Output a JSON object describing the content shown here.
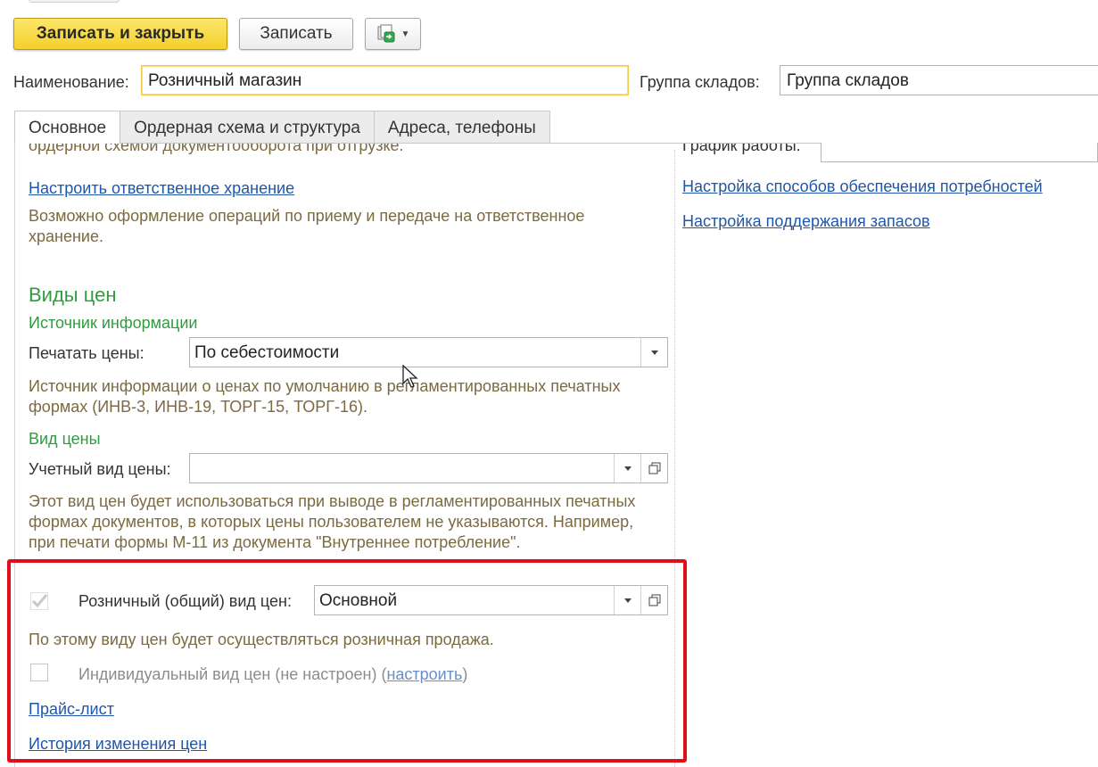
{
  "toolbar": {
    "save_close_label": "Записать и закрыть",
    "save_label": "Записать",
    "more_icon": "document-structure-icon"
  },
  "header": {
    "name_label": "Наименование:",
    "name_value": "Розничный магазин",
    "group_label": "Группа складов:",
    "group_value": "Группа складов"
  },
  "tabs": [
    {
      "label": "Основное",
      "active": true
    },
    {
      "label": "Ордерная схема и структура",
      "active": false
    },
    {
      "label": "Адреса, телефоны",
      "active": false
    }
  ],
  "left": {
    "clipped_text": "ордерной схемой документооборота при отгрузке.",
    "responsible_link": "Настроить ответственное хранение",
    "responsible_desc": "Возможно оформление операций по приему и передаче на ответственное хранение.",
    "price_types_heading": "Виды цен",
    "info_source_heading": "Источник информации",
    "print_prices_label": "Печатать цены:",
    "print_prices_value": "По себестоимости",
    "print_prices_desc": "Источник информации о ценах по умолчанию в регламентированных печатных формах (ИНВ-3, ИНВ-19, ТОРГ-15, ТОРГ-16).",
    "price_type_heading": "Вид цены",
    "account_price_label": "Учетный вид цены:",
    "account_price_value": "",
    "account_price_desc": "Этот вид цен будет использоваться при выводе в регламентированных печатных формах документов, в которых цены пользователем не указываются. Например, при печати формы М-11 из документа \"Внутреннее потребление\".",
    "retail_checkbox_label": "Розничный (общий) вид цен:",
    "retail_checked": true,
    "retail_value": "Основной",
    "retail_desc": "По этому виду цен будет осуществляться розничная продажа.",
    "individual_label": "Индивидуальный вид цен (не настроен) (",
    "individual_link": "настроить",
    "individual_close": ")",
    "individual_checked": false,
    "price_list_link": "Прайс-лист",
    "history_link": "История изменения цен"
  },
  "right": {
    "clipped_label": "График работы:",
    "needs_link": "Настройка способов обеспечения потребностей",
    "stock_link": "Настройка поддержания запасов"
  },
  "colors": {
    "accent_yellow": "#f3d02c",
    "heading_green": "#2f9d3f",
    "link_blue": "#1f56a8",
    "hint_brown": "#7c6a40",
    "highlight_red": "#e0101a"
  }
}
